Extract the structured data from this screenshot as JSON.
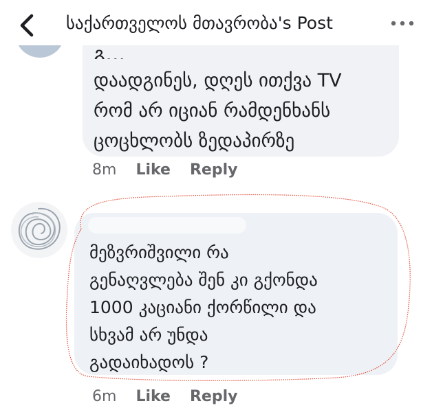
{
  "header": {
    "title": "საქართველოს მთავრობა's Post",
    "back_icon": "chevron-left-icon",
    "more_icon": "more-horizontal-icon"
  },
  "comments": [
    {
      "cut_text": "გ...",
      "lines": [
        "დაადგინეს, დღეს ითქვა TV",
        "რომ არ იციან რამდენხანს",
        "ცოცხლობს ზედაპირზე"
      ],
      "time": "8m",
      "like_label": "Like",
      "reply_label": "Reply"
    },
    {
      "lines": [
        "მეზვრიშვილი რა",
        "გენაღვლება შენ კი გქონდა",
        "1000  კაციანი ქორწილი და",
        "სხვამ არ უნდა",
        "გადაიხადოს ?"
      ],
      "time": "6m",
      "like_label": "Like",
      "reply_label": "Reply"
    }
  ],
  "colors": {
    "bubble": "#f0f2f5",
    "meta_text": "#65676b",
    "annotation_red": "#e0503c"
  }
}
